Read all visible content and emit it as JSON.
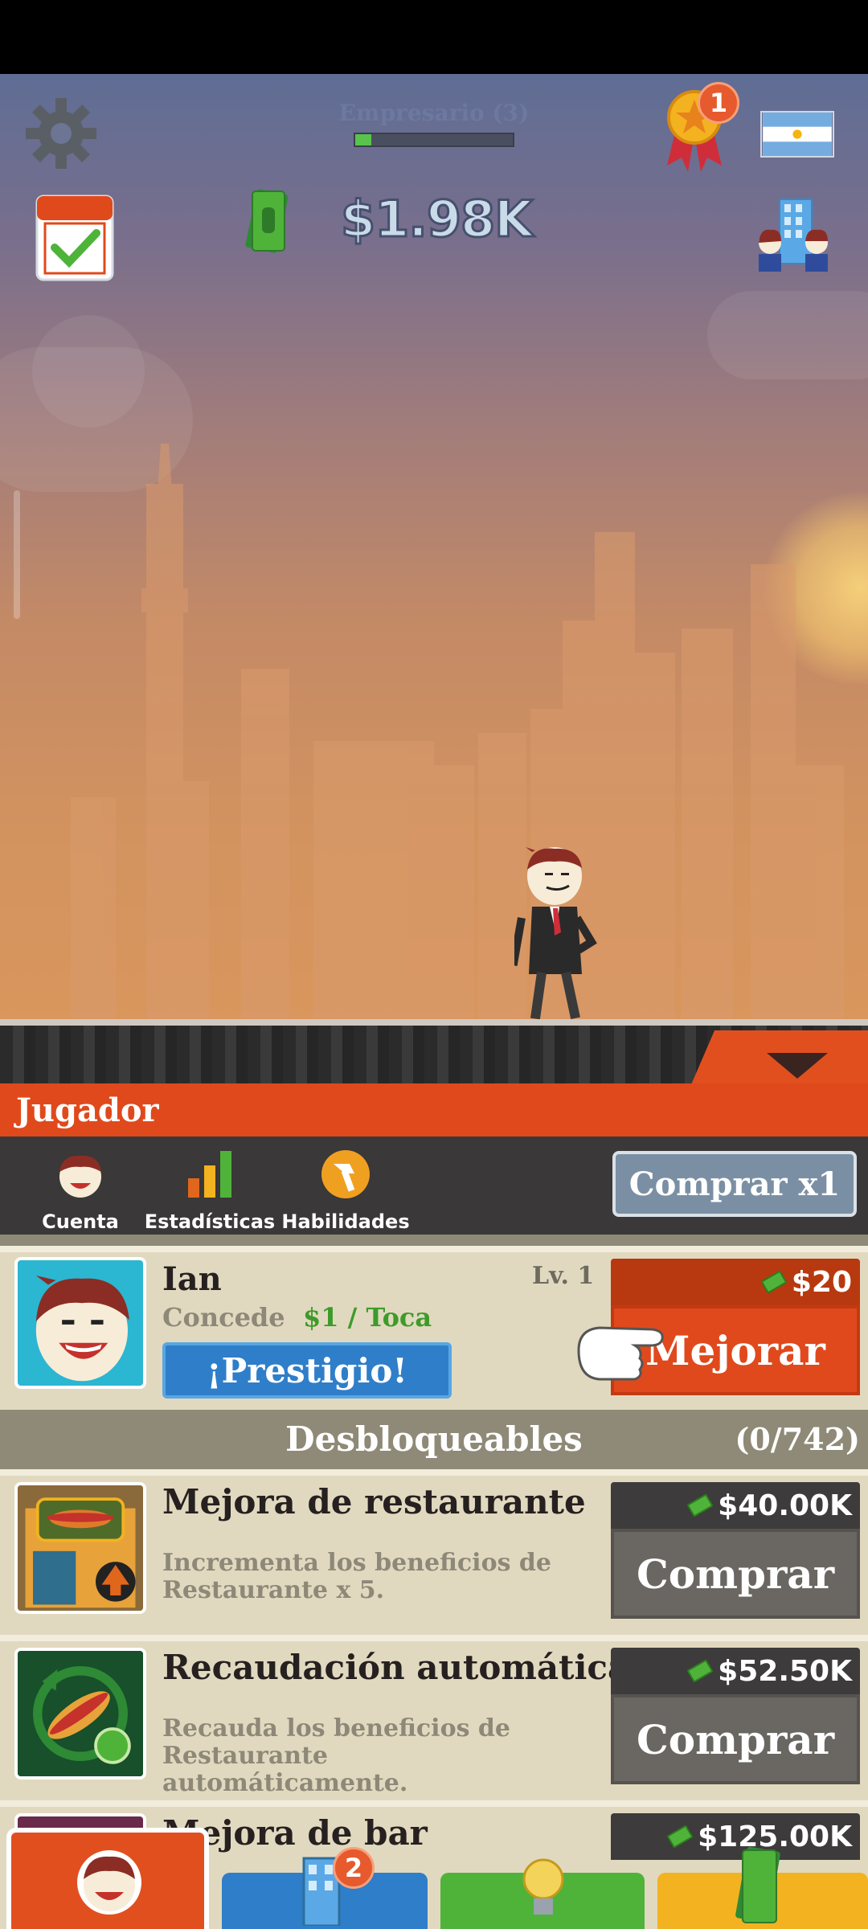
{
  "hud": {
    "level_label": "Empresario (3)",
    "xp_progress": 0.1,
    "money": "$1.98K",
    "achievements_badge": "1",
    "flag": "argentina-flag-icon"
  },
  "panel": {
    "title": "Jugador",
    "tabs": [
      {
        "label": "Cuenta",
        "icon": "avatar-face-icon"
      },
      {
        "label": "Estadísticas",
        "icon": "bar-chart-icon"
      },
      {
        "label": "Habilidades",
        "icon": "skills-hammer-icon"
      }
    ],
    "buy_multiplier": "Comprar x1"
  },
  "player": {
    "name": "Ian",
    "level": "Lv. 1",
    "grants_label": "Concede",
    "grants_value": "$1 / Toca",
    "prestige": "¡Prestigio!",
    "upgrade_price": "$20",
    "upgrade_label": "Mejorar"
  },
  "unlockables": {
    "title": "Desbloqueables",
    "count": "(0/742)",
    "items": [
      {
        "title": "Mejora de restaurante",
        "desc": "Incrementa los beneficios de Restaurante x 5.",
        "price": "$40.00K",
        "action": "Comprar"
      },
      {
        "title": "Recaudación automática",
        "desc": "Recauda los beneficios de Restaurante automáticamente.",
        "price": "$52.50K",
        "action": "Comprar"
      },
      {
        "title": "Mejora de bar",
        "price": "$125.00K"
      }
    ]
  },
  "bottom_nav": {
    "businesses_badge": "2"
  },
  "colors": {
    "accent": "#e0491c",
    "prestige_blue": "#2f7ec9",
    "money_green": "#3e9b2a"
  }
}
